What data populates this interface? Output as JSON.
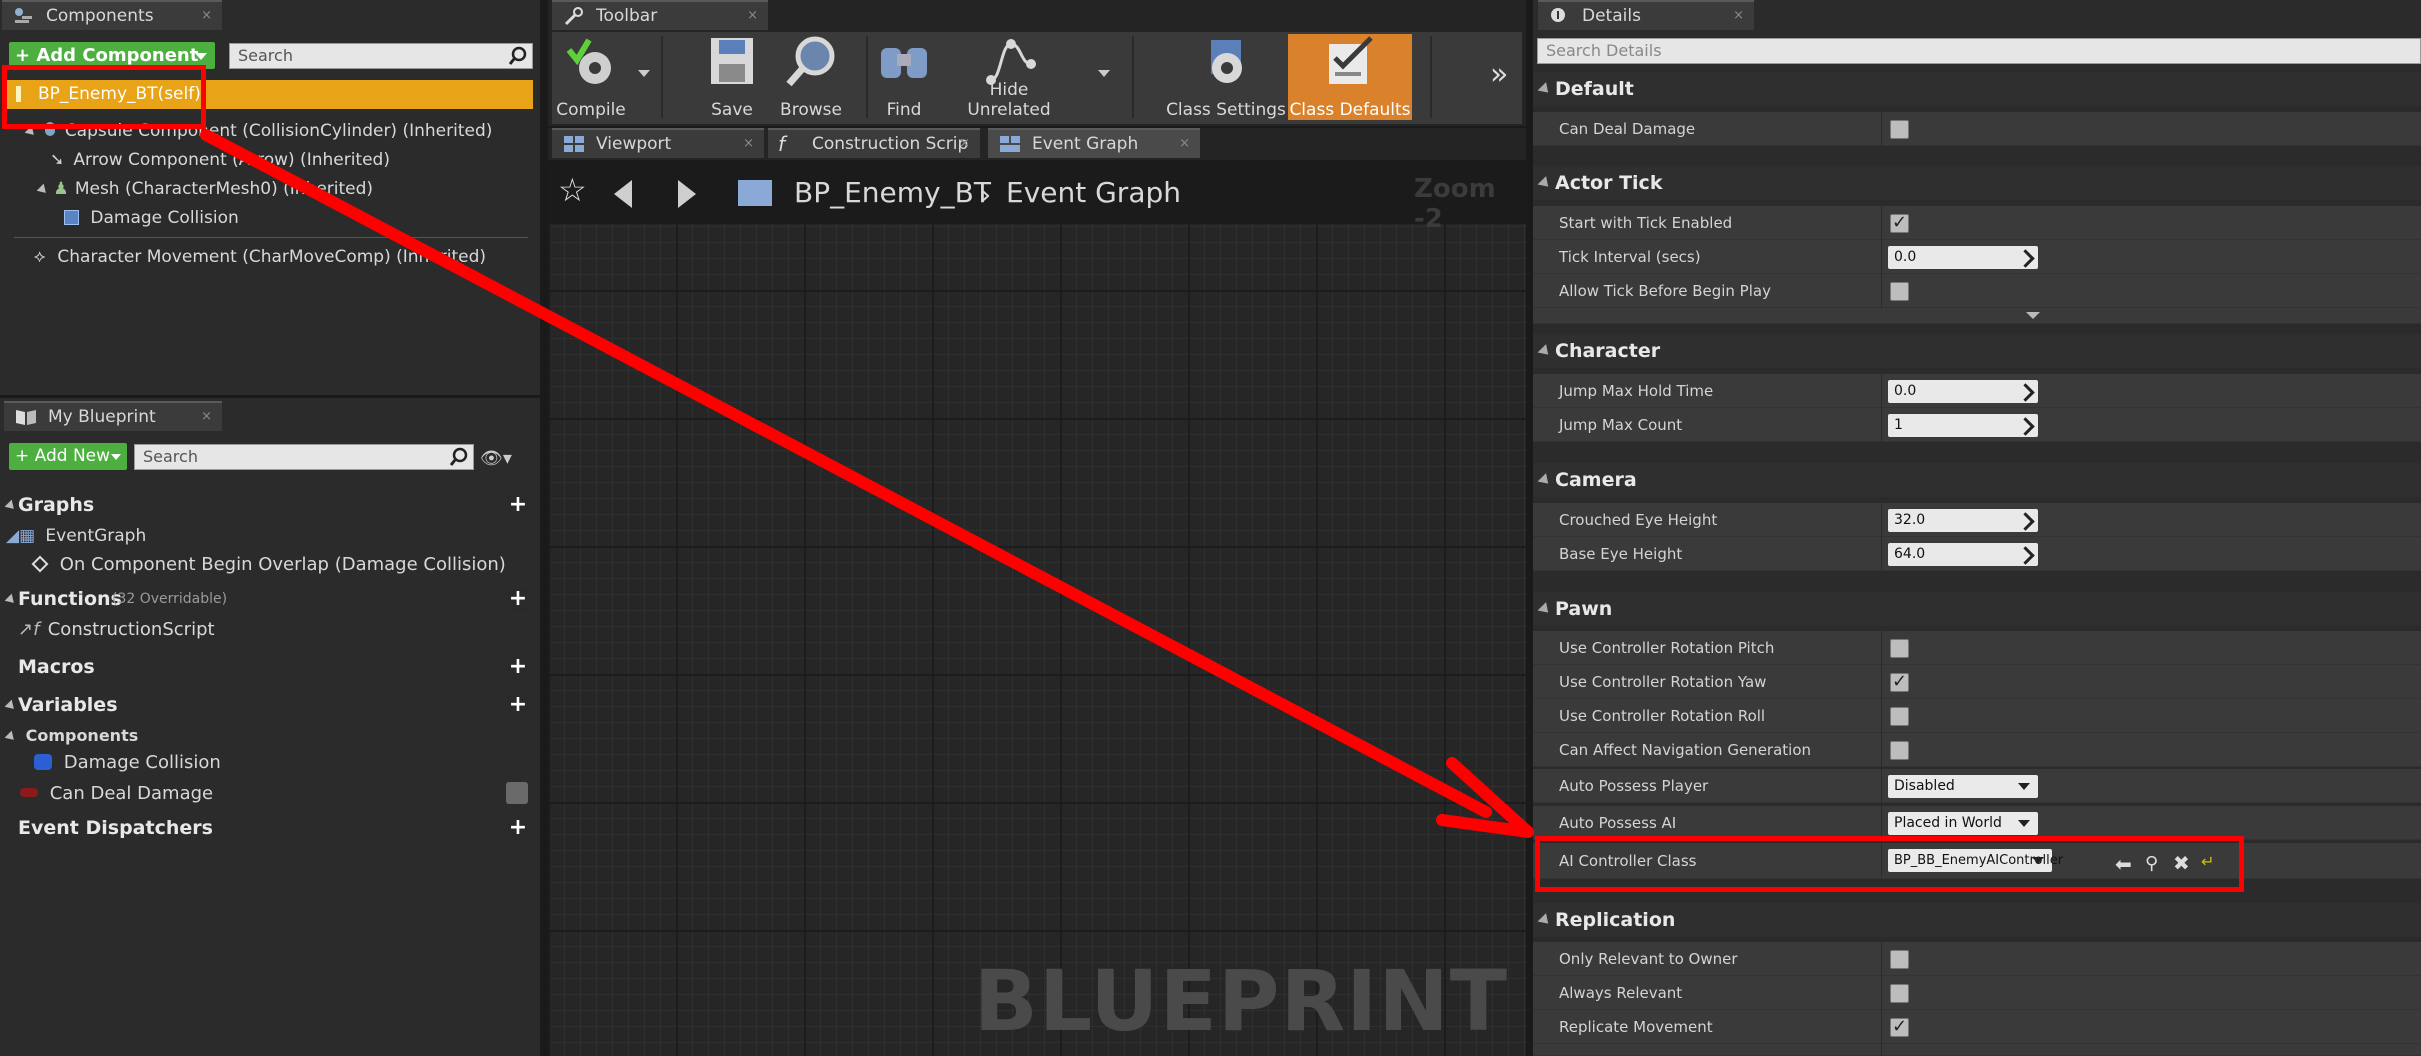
{
  "components_panel": {
    "tab_label": "Components",
    "add_button": "+ Add Component",
    "search_placeholder": "Search",
    "tree": [
      {
        "label": "BP_Enemy_BT(self)"
      },
      {
        "label": "Capsule Component (CollisionCylinder) (Inherited)"
      },
      {
        "label": "Arrow Component (Arrow) (Inherited)"
      },
      {
        "label": "Mesh (CharacterMesh0) (Inherited)"
      },
      {
        "label": "Damage Collision"
      },
      {
        "label": "Character Movement (CharMoveComp) (Inherited)"
      }
    ]
  },
  "my_blueprint": {
    "tab_label": "My Blueprint",
    "add_button": "+ Add New",
    "search_placeholder": "Search",
    "sections": {
      "graphs": "Graphs",
      "event_graph": "EventGraph",
      "overlap_event": "On Component Begin Overlap (Damage Collision)",
      "functions": "Functions",
      "functions_note": "(32 Overridable)",
      "construction_script": "ConstructionScript",
      "macros": "Macros",
      "variables": "Variables",
      "components": "Components",
      "var_damage_collision": "Damage Collision",
      "var_can_deal_damage": "Can Deal Damage",
      "event_dispatchers": "Event Dispatchers"
    }
  },
  "toolbar": {
    "tab_label": "Toolbar",
    "buttons": {
      "compile": "Compile",
      "save": "Save",
      "browse": "Browse",
      "find": "Find",
      "hide_unrelated": "Hide Unrelated",
      "class_settings": "Class Settings",
      "class_defaults": "Class Defaults"
    }
  },
  "editor_tabs": {
    "viewport": "Viewport",
    "construction": "Construction Scrip",
    "event_graph": "Event Graph"
  },
  "graph": {
    "breadcrumb_root": "BP_Enemy_BT",
    "breadcrumb_leaf": "Event Graph",
    "zoom": "Zoom -2",
    "watermark": "BLUEPRINT"
  },
  "details": {
    "tab_label": "Details",
    "search_placeholder": "Search Details",
    "sections": {
      "default": "Default",
      "actor_tick": "Actor Tick",
      "character": "Character",
      "camera": "Camera",
      "pawn": "Pawn",
      "replication": "Replication"
    },
    "rows": {
      "can_deal_damage": "Can Deal Damage",
      "start_with_tick": "Start with Tick Enabled",
      "tick_interval": "Tick Interval (secs)",
      "tick_interval_val": "0.0",
      "allow_tick": "Allow Tick Before Begin Play",
      "jump_hold": "Jump Max Hold Time",
      "jump_hold_val": "0.0",
      "jump_count": "Jump Max Count",
      "jump_count_val": "1",
      "crouched_eye": "Crouched Eye Height",
      "crouched_eye_val": "32.0",
      "base_eye": "Base Eye Height",
      "base_eye_val": "64.0",
      "rot_pitch": "Use Controller Rotation Pitch",
      "rot_yaw": "Use Controller Rotation Yaw",
      "rot_roll": "Use Controller Rotation Roll",
      "nav_gen": "Can Affect Navigation Generation",
      "auto_player": "Auto Possess Player",
      "auto_player_val": "Disabled",
      "auto_ai": "Auto Possess AI",
      "auto_ai_val": "Placed in World",
      "ai_controller": "AI Controller Class",
      "ai_controller_val": "BP_BB_EnemyAIController",
      "only_relevant": "Only Relevant to Owner",
      "always_relevant": "Always Relevant",
      "replicate_movement": "Replicate Movement"
    }
  },
  "colors": {
    "highlight": "#e8a317",
    "annotation_red": "#ff0000",
    "add_green": "#4caf3f",
    "class_defaults_orange": "#d9822b"
  }
}
